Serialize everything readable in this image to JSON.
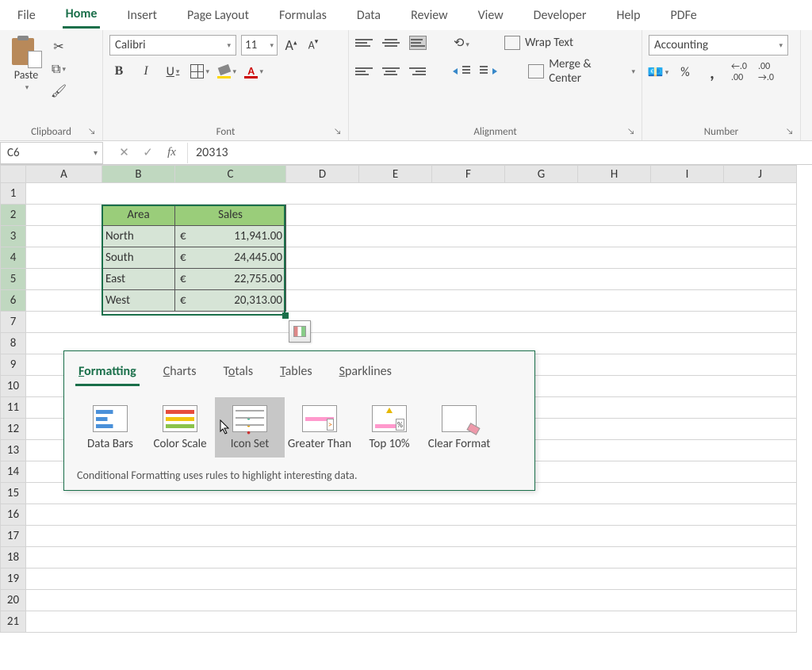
{
  "ribbon_tabs": {
    "file": "File",
    "home": "Home",
    "insert": "Insert",
    "page_layout": "Page Layout",
    "formulas": "Formulas",
    "data": "Data",
    "review": "Review",
    "view": "View",
    "developer": "Developer",
    "help": "Help",
    "pdf": "PDFe"
  },
  "clipboard": {
    "paste": "Paste",
    "label": "Clipboard"
  },
  "font": {
    "name": "Calibri",
    "size": "11",
    "bold": "B",
    "italic": "I",
    "underline": "U",
    "grow": "A",
    "shrink": "A",
    "colorchar": "A",
    "label": "Font"
  },
  "alignment": {
    "wrap": "Wrap Text",
    "merge": "Merge & Center",
    "label": "Alignment"
  },
  "number": {
    "format": "Accounting",
    "percent": "%",
    "comma": "❟",
    "label": "Number"
  },
  "formula_bar": {
    "name_box": "C6",
    "value": "20313",
    "fx": "fx"
  },
  "columns": [
    "A",
    "B",
    "C",
    "D",
    "E",
    "F",
    "G",
    "H",
    "I",
    "J"
  ],
  "table": {
    "header_area": "Area",
    "header_sales": "Sales",
    "rows": [
      {
        "area": "North",
        "currency": "€",
        "sales": "11,941.00"
      },
      {
        "area": "South",
        "currency": "€",
        "sales": "24,445.00"
      },
      {
        "area": "East",
        "currency": "€",
        "sales": "22,755.00"
      },
      {
        "area": "West",
        "currency": "€",
        "sales": "20,313.00"
      }
    ]
  },
  "quick_analysis": {
    "tabs": {
      "formatting": "ormatting",
      "formatting_u": "F",
      "charts": "harts",
      "charts_u": "C",
      "totals": "tals",
      "totals_pre": "T",
      "totals_u": "o",
      "tables": "ables",
      "tables_u": "T",
      "sparklines": "parklines",
      "sparklines_u": "S"
    },
    "items": {
      "data_bars": "Data Bars",
      "color_scale": "Color Scale",
      "icon_set": "Icon Set",
      "greater_than": "Greater Than",
      "top_10": "Top 10%",
      "clear_format": "Clear Format"
    },
    "desc": "Conditional Formatting uses rules to highlight interesting data."
  }
}
